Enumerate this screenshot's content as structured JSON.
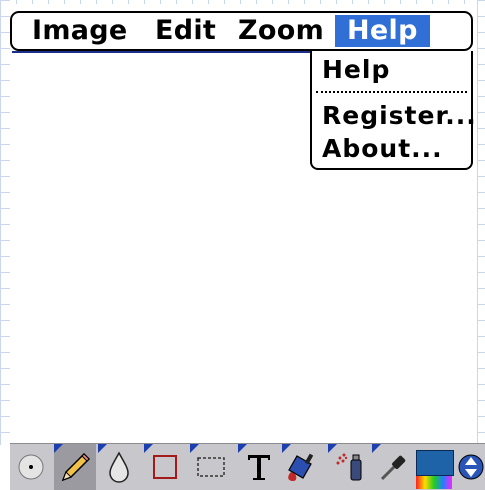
{
  "menubar": {
    "items": [
      "Image",
      "Edit",
      "Zoom",
      "Help"
    ],
    "active": "Help"
  },
  "help_menu": {
    "items": [
      "Help",
      "Register...",
      "About..."
    ]
  },
  "toolbar": {
    "tools": [
      "dot-brush-icon",
      "pencil-icon",
      "water-drop-icon",
      "rectangle-icon",
      "selection-icon",
      "text-icon",
      "paint-bucket-icon",
      "spray-can-icon",
      "eyedropper-icon",
      "color-swatch",
      "scroll-arrows"
    ],
    "selected_tool": "pencil-icon",
    "colors": {
      "current": "#1e62a8",
      "highlight": "#2f6fd6",
      "corner_marker": "#1b3fb0"
    }
  }
}
